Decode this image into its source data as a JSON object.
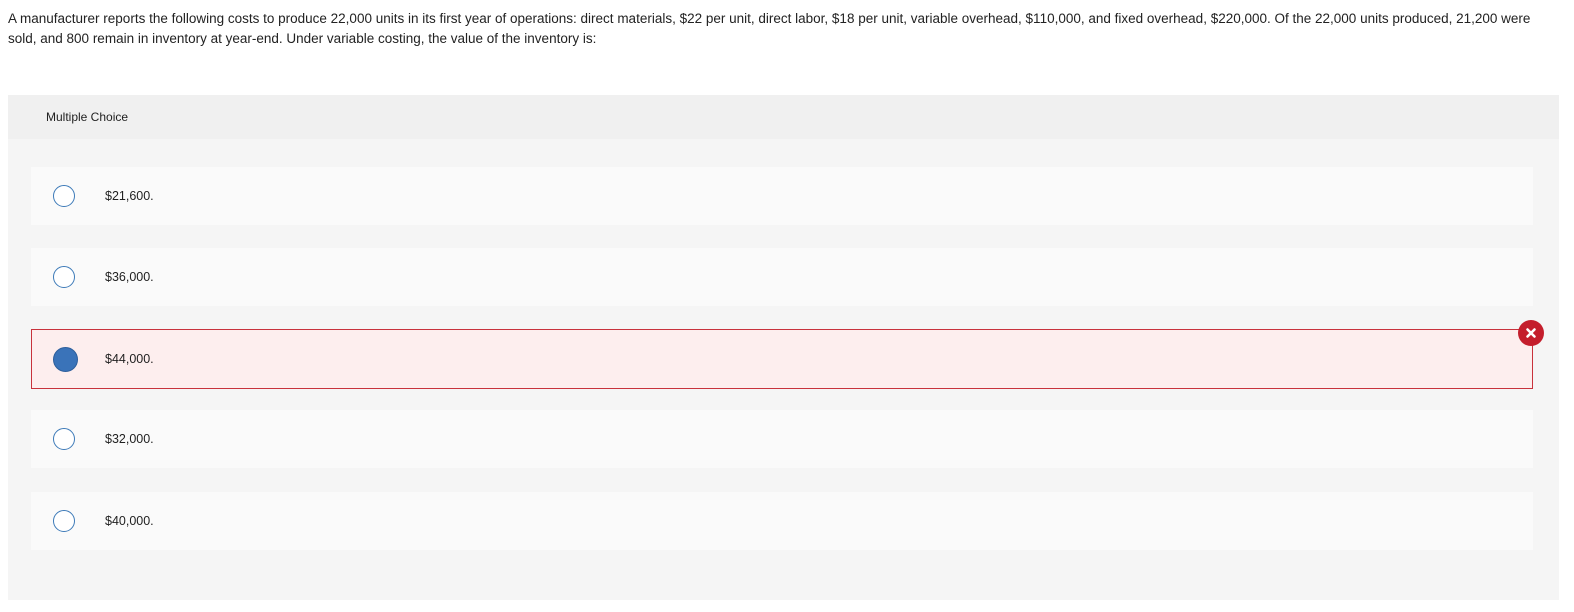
{
  "question": {
    "text": "A manufacturer reports the following costs to produce 22,000 units in its first year of operations: direct materials, $22 per unit, direct labor, $18 per unit, variable overhead, $110,000, and fixed overhead, $220,000. Of the 22,000 units produced, 21,200 were sold, and 800 remain in inventory at year-end. Under variable costing, the value of the inventory is:"
  },
  "panel": {
    "header": "Multiple Choice"
  },
  "choices": [
    {
      "label": "$21,600.",
      "selected": false,
      "marked_wrong": false
    },
    {
      "label": "$36,000.",
      "selected": false,
      "marked_wrong": false
    },
    {
      "label": "$44,000.",
      "selected": true,
      "marked_wrong": true
    },
    {
      "label": "$32,000.",
      "selected": false,
      "marked_wrong": false
    },
    {
      "label": "$40,000.",
      "selected": false,
      "marked_wrong": false
    }
  ],
  "icons": {
    "wrong": "x-circle-icon"
  },
  "colors": {
    "radio_border": "#3d7ab8",
    "radio_selected": "#3a73b9",
    "wrong_border": "#c8323c",
    "wrong_background": "#fdeeee",
    "wrong_icon": "#c41e2c"
  }
}
